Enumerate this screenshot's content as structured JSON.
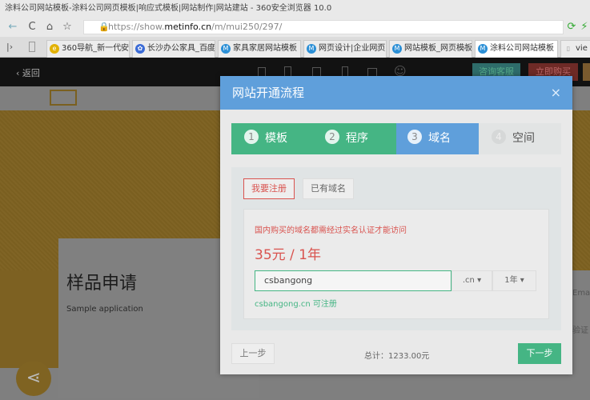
{
  "browser": {
    "title": "涂料公司网站模板-涂料公司网页模板|响应式模板|网站制作|网站建站 - 360安全浏览器 10.0",
    "url_prefix": "https://show.",
    "url_domain": "metinfo.cn",
    "url_path": "/m/mui250/297/",
    "tabs": [
      {
        "label": "360导航_新一代安"
      },
      {
        "label": "长沙办公家具_百度"
      },
      {
        "label": "家具家居网站模板"
      },
      {
        "label": "网页设计|企业网页"
      },
      {
        "label": "网站模板_网页模板"
      },
      {
        "label": "涂料公司网站模板",
        "active": true
      },
      {
        "label": "vie"
      }
    ]
  },
  "sitenav": {
    "back": "返回",
    "consult": "咨询客服",
    "buy": "立即购买"
  },
  "page": {
    "section_title": "样品申请",
    "section_subtitle": "Sample application",
    "field_email": "Email",
    "field_code": "验证"
  },
  "modal": {
    "title": "网站开通流程",
    "close": "×",
    "steps": [
      {
        "num": "1",
        "label": "模板",
        "state": "done"
      },
      {
        "num": "2",
        "label": "程序",
        "state": "done"
      },
      {
        "num": "3",
        "label": "域名",
        "state": "active"
      },
      {
        "num": "4",
        "label": "空间",
        "state": "todo"
      }
    ],
    "tab_register": "我要注册",
    "tab_existing": "已有域名",
    "notice": "国内购买的域名都需经过实名认证才能访问",
    "price": "35元 / 1年",
    "domain_input": "csbangong",
    "suffix": ".cn",
    "years": "1年",
    "availability": "csbangong.cn 可注册",
    "prev": "上一步",
    "total": "总计：1233.00元",
    "next": "下一步"
  },
  "colors": {
    "green": "#45b584",
    "blue": "#5f9fdb",
    "red": "#d9534f"
  }
}
